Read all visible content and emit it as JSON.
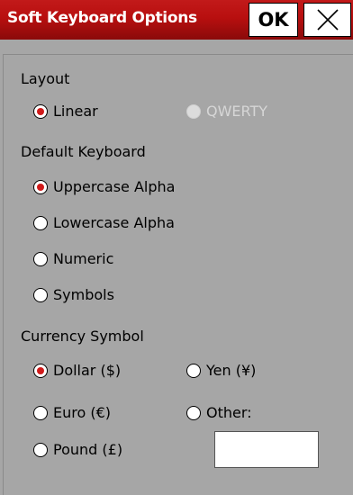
{
  "window": {
    "title": "Soft Keyboard Options",
    "ok_label": "OK"
  },
  "layout": {
    "heading": "Layout",
    "options": [
      {
        "label": "Linear",
        "checked": true,
        "enabled": true
      },
      {
        "label": "QWERTY",
        "checked": false,
        "enabled": false
      }
    ]
  },
  "default_keyboard": {
    "heading": "Default Keyboard",
    "options": [
      {
        "label": "Uppercase Alpha",
        "checked": true
      },
      {
        "label": "Lowercase Alpha",
        "checked": false
      },
      {
        "label": "Numeric",
        "checked": false
      },
      {
        "label": "Symbols",
        "checked": false
      }
    ]
  },
  "currency": {
    "heading": "Currency Symbol",
    "options": [
      {
        "label": "Dollar ($)",
        "checked": true
      },
      {
        "label": "Yen (¥)",
        "checked": false
      },
      {
        "label": "Euro (€)",
        "checked": false
      },
      {
        "label": "Other:",
        "checked": false
      },
      {
        "label": "Pound (£)",
        "checked": false
      }
    ],
    "other_value": ""
  },
  "colors": {
    "titlebar": "#b80f0f",
    "background": "#a6a6a6",
    "radio_dot": "#d01a1a"
  }
}
